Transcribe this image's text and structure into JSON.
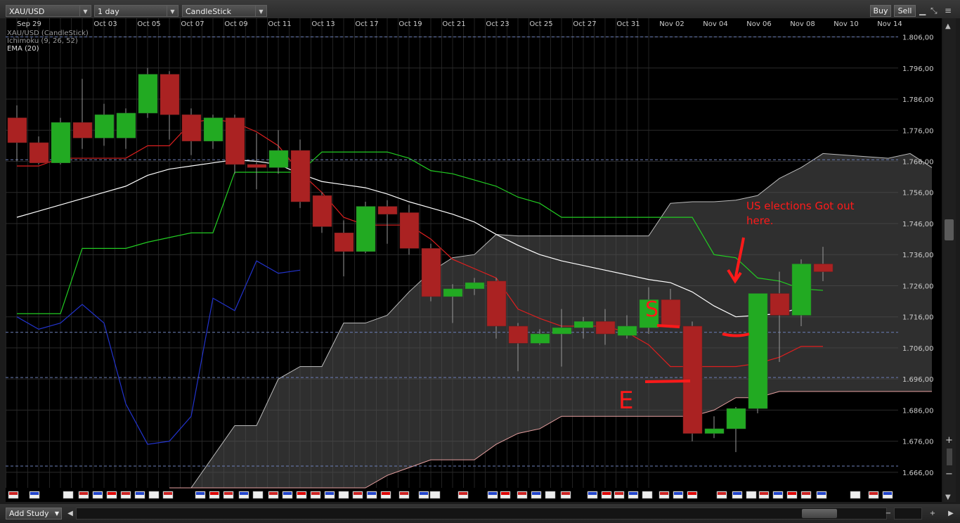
{
  "toolbar": {
    "symbol": "XAU/USD",
    "period": "1 day",
    "chart_type": "CandleStick",
    "buy_label": "Buy",
    "sell_label": "Sell"
  },
  "chart_info": {
    "line1": "XAU/USD (CandleStick)",
    "line2": "Ichimoku (9, 26, 52)",
    "line3": "EMA (20)"
  },
  "annotation": {
    "text_line1": "US elections Got out",
    "text_line2": "here.",
    "marker_s": "S",
    "marker_e": "E",
    "color": "#ff1a1a"
  },
  "bottombar": {
    "add_study_label": "Add Study"
  },
  "colors": {
    "background": "#000000",
    "bull": "#22aa22",
    "bear": "#aa2222",
    "tenkan": "#dd1f1f",
    "kijun": "#22cc22",
    "chikou": "#2233cc",
    "ema": "#ffffff",
    "cloud": "#888888"
  },
  "chart_data": {
    "type": "candlestick",
    "symbol": "XAU/USD",
    "period": "1 day",
    "x_tick_labels": [
      "Sep 29",
      "Oct 03",
      "Oct 05",
      "Oct 07",
      "Oct 09",
      "Oct 11",
      "Oct 13",
      "Oct 17",
      "Oct 19",
      "Oct 21",
      "Oct 23",
      "Oct 25",
      "Oct 27",
      "Oct 31",
      "Nov 02",
      "Nov 04",
      "Nov 06",
      "Nov 08",
      "Nov 10",
      "Nov 14"
    ],
    "y_tick_labels": [
      "1.806,00",
      "1.796,00",
      "1.786,00",
      "1.776,00",
      "1.766,00",
      "1.756,00",
      "1.746,00",
      "1.736,00",
      "1.726,00",
      "1.716,00",
      "1.706,00",
      "1.696,00",
      "1.686,00",
      "1.676,00",
      "1.666,00"
    ],
    "ylim": [
      1661.0,
      1812.0
    ],
    "dashed_levels": [
      1806.0,
      1766.5,
      1711.0,
      1696.5,
      1668.0
    ],
    "candles": [
      {
        "o": 1780.0,
        "h": 1784.0,
        "l": 1766.0,
        "c": 1772.0
      },
      {
        "o": 1772.0,
        "h": 1774.0,
        "l": 1765.0,
        "c": 1765.5
      },
      {
        "o": 1765.5,
        "h": 1780.0,
        "l": 1765.0,
        "c": 1778.5
      },
      {
        "o": 1778.5,
        "h": 1792.5,
        "l": 1770.0,
        "c": 1773.5
      },
      {
        "o": 1773.5,
        "h": 1784.5,
        "l": 1771.0,
        "c": 1781.0
      },
      {
        "o": 1773.5,
        "h": 1783.0,
        "l": 1770.0,
        "c": 1781.5
      },
      {
        "o": 1781.5,
        "h": 1796.0,
        "l": 1780.0,
        "c": 1794.0
      },
      {
        "o": 1794.0,
        "h": 1795.0,
        "l": 1773.0,
        "c": 1781.0
      },
      {
        "o": 1781.0,
        "h": 1783.0,
        "l": 1768.0,
        "c": 1772.5
      },
      {
        "o": 1772.5,
        "h": 1781.0,
        "l": 1770.0,
        "c": 1780.0
      },
      {
        "o": 1780.0,
        "h": 1781.0,
        "l": 1762.0,
        "c": 1765.0
      },
      {
        "o": 1765.0,
        "h": 1775.0,
        "l": 1757.0,
        "c": 1764.0
      },
      {
        "o": 1764.0,
        "h": 1776.0,
        "l": 1762.0,
        "c": 1769.5
      },
      {
        "o": 1769.5,
        "h": 1773.0,
        "l": 1751.0,
        "c": 1753.0
      },
      {
        "o": 1755.0,
        "h": 1756.0,
        "l": 1743.0,
        "c": 1745.0
      },
      {
        "o": 1743.0,
        "h": 1747.0,
        "l": 1729.0,
        "c": 1737.0
      },
      {
        "o": 1737.0,
        "h": 1753.0,
        "l": 1736.5,
        "c": 1751.5
      },
      {
        "o": 1751.5,
        "h": 1753.5,
        "l": 1739.5,
        "c": 1749.0
      },
      {
        "o": 1749.5,
        "h": 1752.0,
        "l": 1736.0,
        "c": 1738.0
      },
      {
        "o": 1738.0,
        "h": 1739.5,
        "l": 1721.0,
        "c": 1722.5
      },
      {
        "o": 1722.5,
        "h": 1726.5,
        "l": 1714.0,
        "c": 1725.0
      },
      {
        "o": 1725.0,
        "h": 1728.5,
        "l": 1723.0,
        "c": 1727.0
      },
      {
        "o": 1727.5,
        "h": 1728.5,
        "l": 1709.0,
        "c": 1713.0
      },
      {
        "o": 1713.0,
        "h": 1714.0,
        "l": 1698.5,
        "c": 1707.5
      },
      {
        "o": 1707.5,
        "h": 1712.0,
        "l": 1707.0,
        "c": 1710.5
      },
      {
        "o": 1710.5,
        "h": 1718.5,
        "l": 1700.0,
        "c": 1712.5
      },
      {
        "o": 1712.5,
        "h": 1716.0,
        "l": 1709.0,
        "c": 1714.5
      },
      {
        "o": 1714.5,
        "h": 1718.5,
        "l": 1707.0,
        "c": 1710.5
      },
      {
        "o": 1710.0,
        "h": 1716.5,
        "l": 1709.0,
        "c": 1713.0
      },
      {
        "o": 1712.5,
        "h": 1725.5,
        "l": 1710.5,
        "c": 1721.5
      },
      {
        "o": 1721.5,
        "h": 1725.0,
        "l": 1712.5,
        "c": 1713.0
      },
      {
        "o": 1713.0,
        "h": 1714.5,
        "l": 1676.0,
        "c": 1678.5
      },
      {
        "o": 1678.5,
        "h": 1684.0,
        "l": 1677.0,
        "c": 1680.0
      },
      {
        "o": 1680.0,
        "h": 1687.0,
        "l": 1672.5,
        "c": 1686.5
      },
      {
        "o": 1686.5,
        "h": 1723.5,
        "l": 1685.0,
        "c": 1723.5
      },
      {
        "o": 1723.5,
        "h": 1730.5,
        "l": 1701.5,
        "c": 1716.5
      },
      {
        "o": 1716.5,
        "h": 1734.5,
        "l": 1713.0,
        "c": 1733.0
      },
      {
        "o": 1733.0,
        "h": 1738.5,
        "l": 1727.5,
        "c": 1730.5
      }
    ],
    "ichimoku": {
      "params": [
        9,
        26,
        52
      ],
      "tenkan": [
        1764.5,
        1764.5,
        1767.0,
        1767.0,
        1767.0,
        1767.0,
        1771.0,
        1771.0,
        1778.5,
        1779.5,
        1778.5,
        1775.5,
        1771.0,
        1762.5,
        1756.0,
        1748.0,
        1745.5,
        1745.5,
        1745.5,
        1741.0,
        1734.5,
        1731.5,
        1728.5,
        1718.5,
        1715.5,
        1713.0,
        1713.0,
        1713.0,
        1711.0,
        1707.0,
        1700.0,
        1700.0,
        1700.0,
        1700.0,
        1701.0,
        1703.0,
        1706.5,
        1706.5
      ],
      "kijun": [
        1717.0,
        1717.0,
        1717.0,
        1738.0,
        1738.0,
        1738.0,
        1740.0,
        1741.5,
        1743.0,
        1743.0,
        1762.5,
        1762.5,
        1762.5,
        1762.5,
        1769.0,
        1769.0,
        1769.0,
        1769.0,
        1767.0,
        1763.0,
        1762.0,
        1760.0,
        1758.0,
        1754.5,
        1752.5,
        1748.0,
        1748.0,
        1748.0,
        1748.0,
        1748.0,
        1748.0,
        1748.0,
        1736.0,
        1735.0,
        1728.5,
        1727.5,
        1725.0,
        1724.5
      ]
    },
    "ema_20": [
      1748.0,
      1750.0,
      1752.0,
      1754.0,
      1756.0,
      1758.0,
      1761.5,
      1763.5,
      1764.5,
      1765.5,
      1766.5,
      1766.0,
      1765.0,
      1762.0,
      1759.5,
      1758.5,
      1757.5,
      1755.5,
      1753.0,
      1751.0,
      1749.0,
      1746.5,
      1742.5,
      1739.0,
      1736.0,
      1734.0,
      1732.5,
      1731.0,
      1729.5,
      1728.0,
      1727.0,
      1724.0,
      1719.5,
      1716.0,
      1716.5,
      1717.0,
      1719.0
    ],
    "cloud_span": {
      "start_index": 7,
      "upper": [
        1661.0,
        1661.0,
        1671.0,
        1681.0,
        1681.0,
        1696.0,
        1700.0,
        1700.0,
        1714.0,
        1714.0,
        1716.5,
        1724.0,
        1730.5,
        1735.0,
        1736.0,
        1742.5,
        1742.0,
        1742.0,
        1742.0,
        1742.0,
        1742.0,
        1742.0,
        1742.0,
        1752.5,
        1753.0,
        1753.0,
        1753.5,
        1755.0,
        1760.5,
        1764.0,
        1768.5,
        1768.0,
        1767.5,
        1767.0,
        1768.5,
        1764.0
      ],
      "lower": [
        1661.0,
        1661.0,
        1661.0,
        1661.0,
        1661.0,
        1661.0,
        1661.0,
        1661.0,
        1661.0,
        1661.0,
        1665.0,
        1667.5,
        1670.0,
        1670.0,
        1670.0,
        1675.0,
        1678.5,
        1680.0,
        1684.0,
        1684.0,
        1684.0,
        1684.0,
        1684.0,
        1684.0,
        1684.0,
        1686.0,
        1690.0,
        1690.0,
        1692.0,
        1692.0,
        1692.0,
        1692.0,
        1692.0,
        1692.0,
        1692.0,
        1692.0
      ]
    }
  }
}
